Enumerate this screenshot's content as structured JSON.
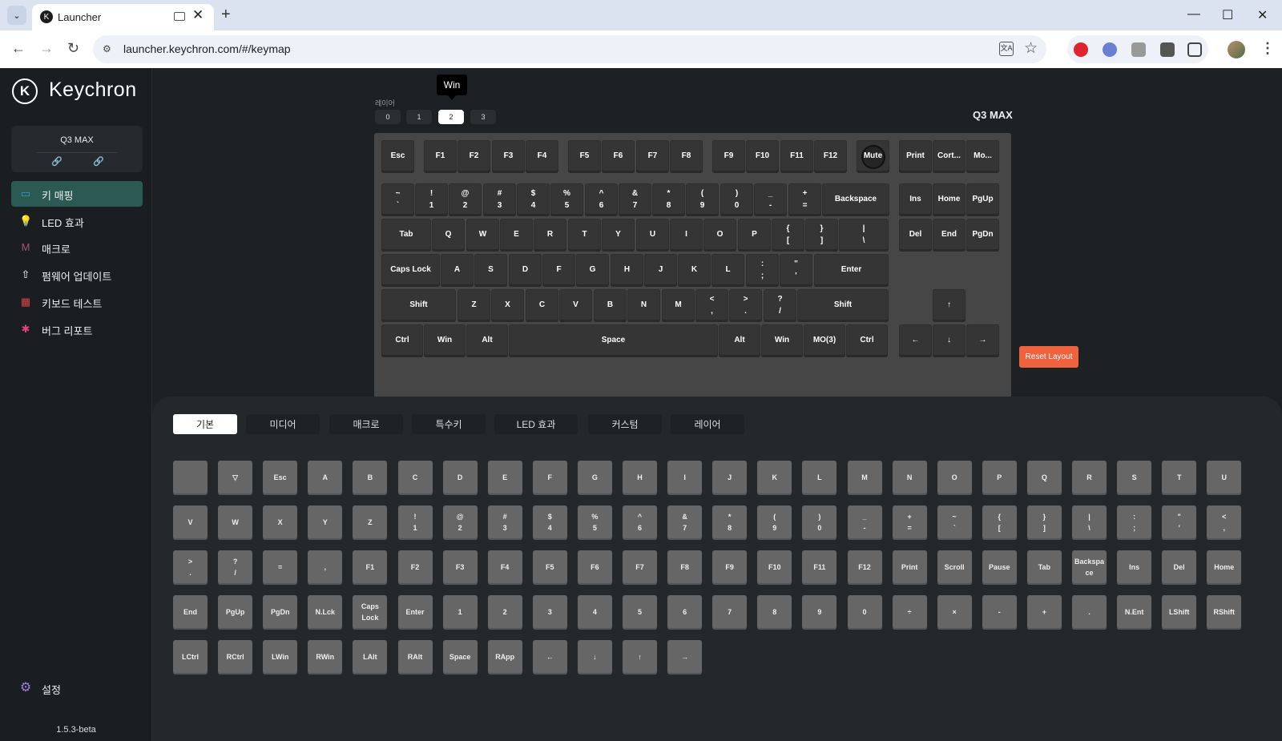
{
  "browser": {
    "tab_title": "Launcher",
    "tab_favicon": "K",
    "url": "launcher.keychron.com/#/keymap",
    "new_tab": "+",
    "close_tab": "✕",
    "back": "←",
    "forward": "→",
    "reload": "↻",
    "minimize": "—",
    "maximize": "☐",
    "close": "✕",
    "tab_list": "⌄",
    "translate": "文A",
    "star": "☆",
    "menu": "⋮",
    "site_info": "⚙"
  },
  "sidebar": {
    "logo_mark": "K",
    "logo_text": "Keychron",
    "device_name": "Q3 MAX",
    "device_link_a": "🔗",
    "device_link_b": "🔗",
    "nav": [
      {
        "label": "키 매핑",
        "icon": "keyboard-icon",
        "glyph": "▭",
        "color": "#4a90c8"
      },
      {
        "label": "LED 효과",
        "icon": "bulb-icon",
        "glyph": "💡",
        "color": "#3bbf7a"
      },
      {
        "label": "매크로",
        "icon": "macro-icon",
        "glyph": "M",
        "color": "#a0526e"
      },
      {
        "label": "펌웨어 업데이트",
        "icon": "upload-icon",
        "glyph": "⇧",
        "color": "#ffffff"
      },
      {
        "label": "키보드 테스트",
        "icon": "test-icon",
        "glyph": "▦",
        "color": "#e0424a"
      },
      {
        "label": "버그 리포트",
        "icon": "bug-icon",
        "glyph": "✱",
        "color": "#e0427a"
      }
    ],
    "settings_label": "설정",
    "settings_glyph": "⚙",
    "version": "1.5.3-beta"
  },
  "keyboard": {
    "tooltip": "Win",
    "layer_label": "레이어",
    "layers": [
      "0",
      "1",
      "2",
      "3"
    ],
    "active_layer": 2,
    "model": "Q3 MAX",
    "reset_label": "Reset Layout",
    "keys": [
      [
        "Esc"
      ],
      [
        "F1"
      ],
      [
        "F2"
      ],
      [
        "F3"
      ],
      [
        "F4"
      ],
      [
        "F5"
      ],
      [
        "F6"
      ],
      [
        "F7"
      ],
      [
        "F8"
      ],
      [
        "F9"
      ],
      [
        "F10"
      ],
      [
        "F11"
      ],
      [
        "F12"
      ],
      [
        "Mute"
      ],
      [
        "Print"
      ],
      [
        "Cort..."
      ],
      [
        "Mo..."
      ],
      [
        "~",
        "`"
      ],
      [
        "!",
        "1"
      ],
      [
        "@",
        "2"
      ],
      [
        "#",
        "3"
      ],
      [
        "$",
        "4"
      ],
      [
        "%",
        "5"
      ],
      [
        "^",
        "6"
      ],
      [
        "&",
        "7"
      ],
      [
        "*",
        "8"
      ],
      [
        "(",
        "9"
      ],
      [
        ")",
        "0"
      ],
      [
        "_",
        "-"
      ],
      [
        "+",
        "="
      ],
      [
        "Backspace"
      ],
      [
        "Ins"
      ],
      [
        "Home"
      ],
      [
        "PgUp"
      ],
      [
        "Tab"
      ],
      [
        "Q"
      ],
      [
        "W"
      ],
      [
        "E"
      ],
      [
        "R"
      ],
      [
        "T"
      ],
      [
        "Y"
      ],
      [
        "U"
      ],
      [
        "I"
      ],
      [
        "O"
      ],
      [
        "P"
      ],
      [
        "{",
        "["
      ],
      [
        "}",
        "]"
      ],
      [
        "|",
        "\\"
      ],
      [
        "Del"
      ],
      [
        "End"
      ],
      [
        "PgDn"
      ],
      [
        "Caps Lock"
      ],
      [
        "A"
      ],
      [
        "S"
      ],
      [
        "D"
      ],
      [
        "F"
      ],
      [
        "G"
      ],
      [
        "H"
      ],
      [
        "J"
      ],
      [
        "K"
      ],
      [
        "L"
      ],
      [
        ":",
        ";"
      ],
      [
        "\"",
        "'"
      ],
      [
        "Enter"
      ],
      [
        "Shift"
      ],
      [
        "Z"
      ],
      [
        "X"
      ],
      [
        "C"
      ],
      [
        "V"
      ],
      [
        "B"
      ],
      [
        "N"
      ],
      [
        "M"
      ],
      [
        "<",
        ","
      ],
      [
        ">",
        "."
      ],
      [
        "?",
        "/"
      ],
      [
        "Shift"
      ],
      [
        "↑"
      ],
      [
        "Ctrl"
      ],
      [
        "Win"
      ],
      [
        "Alt"
      ],
      [
        "Space"
      ],
      [
        "Alt"
      ],
      [
        "Win"
      ],
      [
        "MO(3)"
      ],
      [
        "Ctrl"
      ],
      [
        "←"
      ],
      [
        "↓"
      ],
      [
        "→"
      ]
    ]
  },
  "picker": {
    "tabs": [
      "기본",
      "미디어",
      "매크로",
      "특수키",
      "LED 효과",
      "커스텀",
      "레이어"
    ],
    "active_tab": 0,
    "keys": [
      [
        ""
      ],
      [
        "▽"
      ],
      [
        "Esc"
      ],
      [
        "A"
      ],
      [
        "B"
      ],
      [
        "C"
      ],
      [
        "D"
      ],
      [
        "E"
      ],
      [
        "F"
      ],
      [
        "G"
      ],
      [
        "H"
      ],
      [
        "I"
      ],
      [
        "J"
      ],
      [
        "K"
      ],
      [
        "L"
      ],
      [
        "M"
      ],
      [
        "N"
      ],
      [
        "O"
      ],
      [
        "P"
      ],
      [
        "Q"
      ],
      [
        "R"
      ],
      [
        "S"
      ],
      [
        "T"
      ],
      [
        "U"
      ],
      [
        "V"
      ],
      [
        "W"
      ],
      [
        "X"
      ],
      [
        "Y"
      ],
      [
        "Z"
      ],
      [
        "!",
        "1"
      ],
      [
        "@",
        "2"
      ],
      [
        "#",
        "3"
      ],
      [
        "$",
        "4"
      ],
      [
        "%",
        "5"
      ],
      [
        "^",
        "6"
      ],
      [
        "&",
        "7"
      ],
      [
        "*",
        "8"
      ],
      [
        "(",
        "9"
      ],
      [
        ")",
        "0"
      ],
      [
        "_",
        "-"
      ],
      [
        "+",
        "="
      ],
      [
        "~",
        "`"
      ],
      [
        "{",
        "["
      ],
      [
        "}",
        "]"
      ],
      [
        "|",
        "\\"
      ],
      [
        ":",
        ";"
      ],
      [
        "\"",
        "'"
      ],
      [
        "<",
        ","
      ],
      [
        ">",
        "."
      ],
      [
        "?",
        "/"
      ],
      [
        "="
      ],
      [
        ","
      ],
      [
        "F1"
      ],
      [
        "F2"
      ],
      [
        "F3"
      ],
      [
        "F4"
      ],
      [
        "F5"
      ],
      [
        "F6"
      ],
      [
        "F7"
      ],
      [
        "F8"
      ],
      [
        "F9"
      ],
      [
        "F10"
      ],
      [
        "F11"
      ],
      [
        "F12"
      ],
      [
        "Print"
      ],
      [
        "Scroll"
      ],
      [
        "Pause"
      ],
      [
        "Tab"
      ],
      [
        "Backspa",
        "ce"
      ],
      [
        "Ins"
      ],
      [
        "Del"
      ],
      [
        "Home"
      ],
      [
        "End"
      ],
      [
        "PgUp"
      ],
      [
        "PgDn"
      ],
      [
        "N.Lck"
      ],
      [
        "Caps",
        "Lock"
      ],
      [
        "Enter"
      ],
      [
        "1"
      ],
      [
        "2"
      ],
      [
        "3"
      ],
      [
        "4"
      ],
      [
        "5"
      ],
      [
        "6"
      ],
      [
        "7"
      ],
      [
        "8"
      ],
      [
        "9"
      ],
      [
        "0"
      ],
      [
        "÷"
      ],
      [
        "×"
      ],
      [
        "-"
      ],
      [
        "+"
      ],
      [
        "."
      ],
      [
        "N.Ent"
      ],
      [
        "LShift"
      ],
      [
        "RShift"
      ],
      [
        "LCtrl"
      ],
      [
        "RCtrl"
      ],
      [
        "LWin"
      ],
      [
        "RWin"
      ],
      [
        "LAlt"
      ],
      [
        "RAlt"
      ],
      [
        "Space"
      ],
      [
        "RApp"
      ],
      [
        "←"
      ],
      [
        "↓"
      ],
      [
        "↑"
      ],
      [
        "→"
      ]
    ]
  }
}
